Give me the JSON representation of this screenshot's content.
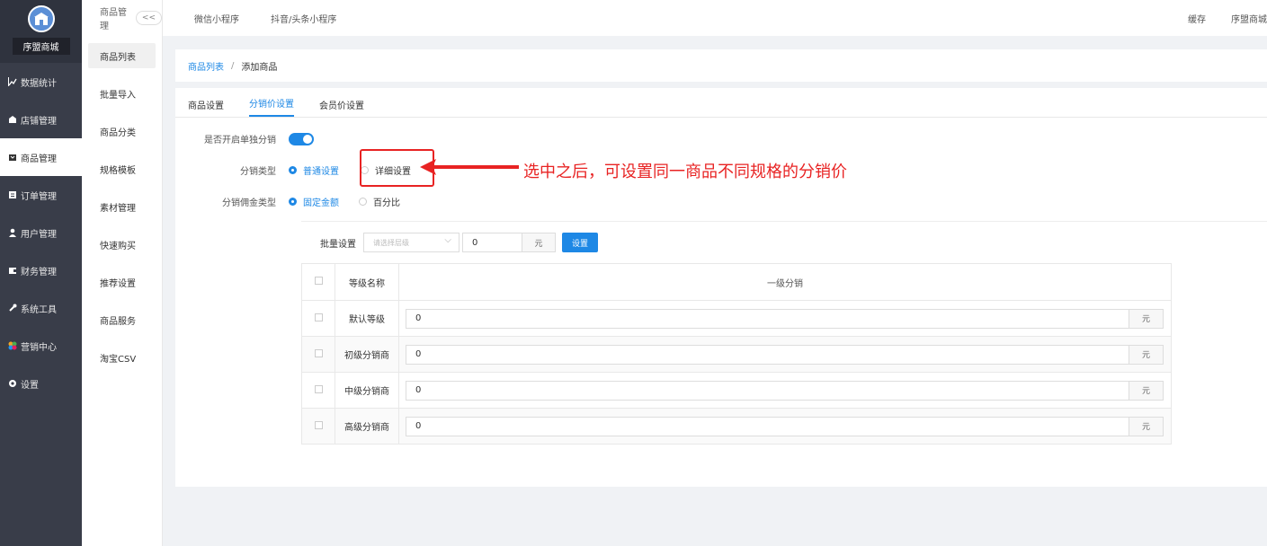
{
  "sidebar": {
    "shop_name": "序盟商城",
    "items": [
      {
        "label": "数据统计",
        "icon": "chart-icon"
      },
      {
        "label": "店铺管理",
        "icon": "shop-icon"
      },
      {
        "label": "商品管理",
        "icon": "goods-icon"
      },
      {
        "label": "订单管理",
        "icon": "order-icon"
      },
      {
        "label": "用户管理",
        "icon": "user-icon"
      },
      {
        "label": "财务管理",
        "icon": "finance-icon"
      },
      {
        "label": "系统工具",
        "icon": "wrench-icon"
      },
      {
        "label": "营销中心",
        "icon": "marketing-icon"
      },
      {
        "label": "设置",
        "icon": "gear-icon"
      }
    ]
  },
  "subnav": {
    "title": "商品管理",
    "collapse": "<<",
    "items": [
      "商品列表",
      "批量导入",
      "商品分类",
      "规格模板",
      "素材管理",
      "快速购买",
      "推荐设置",
      "商品服务",
      "淘宝CSV"
    ]
  },
  "topbar": {
    "tabs": [
      "微信小程序",
      "抖音/头条小程序"
    ],
    "right": [
      "缓存",
      "序盟商城"
    ]
  },
  "breadcrumb": {
    "parent": "商品列表",
    "sep": "/",
    "current": "添加商品"
  },
  "tabs": [
    "商品设置",
    "分销价设置",
    "会员价设置"
  ],
  "form": {
    "enable_label": "是否开启单独分销",
    "type_label": "分销类型",
    "type_options": [
      "普通设置",
      "详细设置"
    ],
    "commission_label": "分销佣金类型",
    "commission_options": [
      "固定金额",
      "百分比"
    ]
  },
  "annotation": "选中之后，可设置同一商品不同规格的分销价",
  "batch": {
    "label": "批量设置",
    "select_placeholder": "请选择层级",
    "value": "0",
    "unit": "元",
    "button": "设置"
  },
  "table": {
    "headers": [
      "等级名称",
      "一级分销"
    ],
    "rows": [
      {
        "name": "默认等级",
        "value": "0",
        "unit": "元"
      },
      {
        "name": "初级分销商",
        "value": "0",
        "unit": "元"
      },
      {
        "name": "中级分销商",
        "value": "0",
        "unit": "元"
      },
      {
        "name": "高级分销商",
        "value": "0",
        "unit": "元"
      }
    ]
  },
  "colors": {
    "accent": "#1e88e5",
    "sidebar": "#393d49",
    "annotation": "#e82323"
  }
}
